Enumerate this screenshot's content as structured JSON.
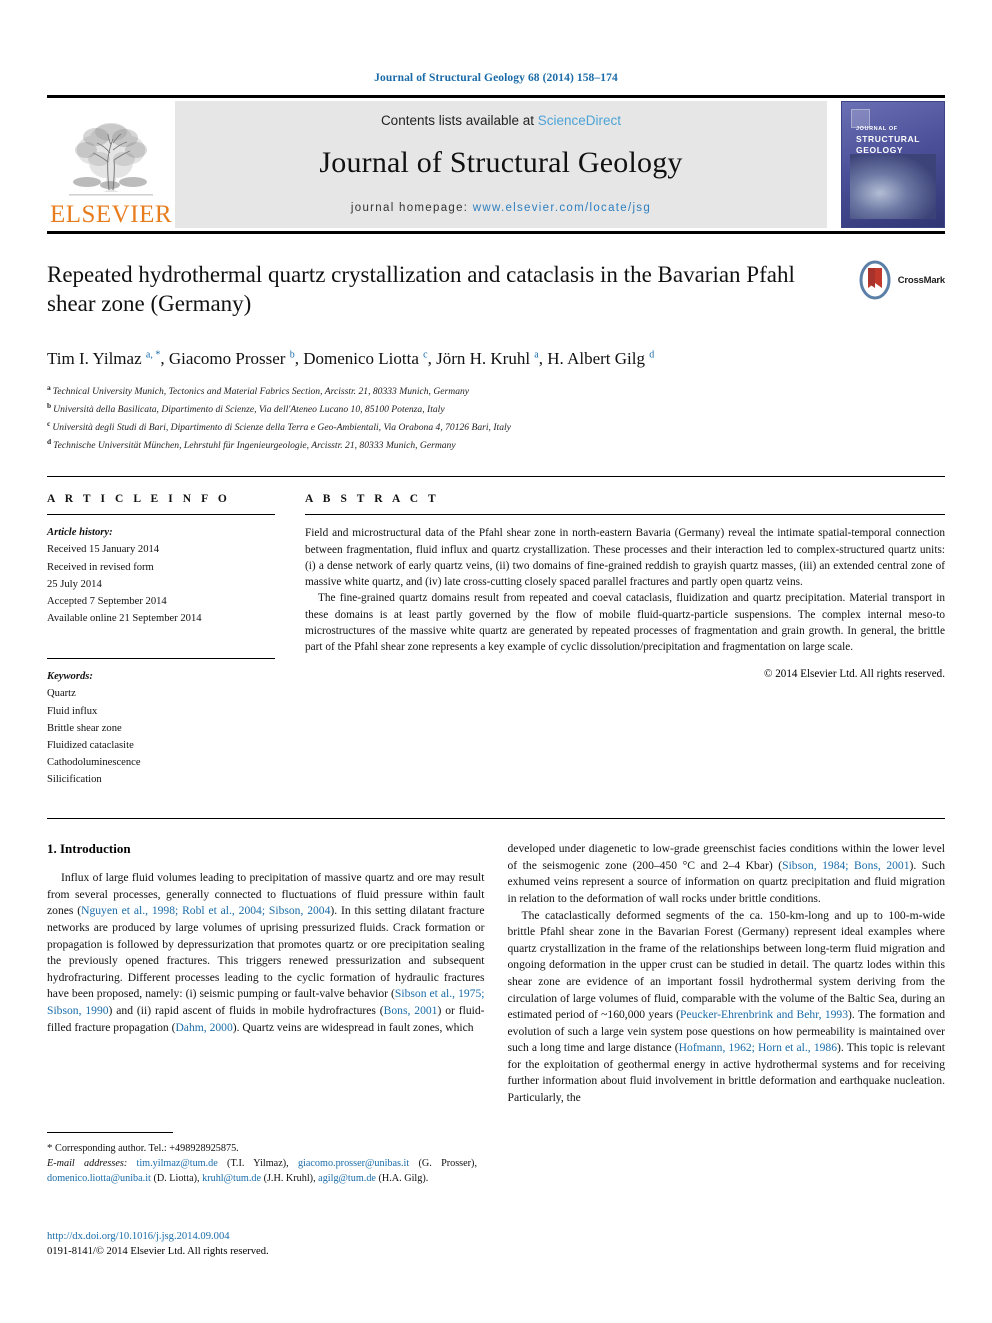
{
  "running_head": "Journal of Structural Geology 68 (2014) 158–174",
  "masthead": {
    "contents_prefix": "Contents lists available at ",
    "sciencedirect": "ScienceDirect",
    "journal_name": "Journal of Structural Geology",
    "homepage_prefix": "journal homepage: ",
    "homepage_url": "www.elsevier.com/locate/jsg",
    "publisher_wordmark": "ELSEVIER",
    "publisher_logo_icon": "elsevier-tree-icon",
    "cover_title_line1": "JOURNAL OF",
    "cover_title_line2": "STRUCTURAL",
    "cover_title_line3": "GEOLOGY"
  },
  "article": {
    "title": "Repeated hydrothermal quartz crystallization and cataclasis in the Bavarian Pfahl shear zone (Germany)",
    "crossmark_label": "CrossMark",
    "crossmark_icon": "crossmark-badge-icon",
    "authors_html": "Tim I. Yilmaz <sup>a, *</sup>, Giacomo Prosser <sup>b</sup>, Domenico Liotta <sup>c</sup>, Jörn H. Kruhl <sup>a</sup>, H. Albert Gilg <sup>d</sup>",
    "affiliations": [
      {
        "marker": "a",
        "text": "Technical University Munich, Tectonics and Material Fabrics Section, Arcisstr. 21, 80333 Munich, Germany"
      },
      {
        "marker": "b",
        "text": "Università della Basilicata, Dipartimento di Scienze, Via dell'Ateneo Lucano 10, 85100 Potenza, Italy"
      },
      {
        "marker": "c",
        "text": "Università degli Studi di Bari, Dipartimento di Scienze della Terra e Geo-Ambientali, Via Orabona 4, 70126 Bari, Italy"
      },
      {
        "marker": "d",
        "text": "Technische Universität München, Lehrstuhl für Ingenieurgeologie, Arcisstr. 21, 80333 Munich, Germany"
      }
    ]
  },
  "article_info": {
    "heading": "A R T I C L E   I N F O",
    "history_label": "Article history:",
    "history_lines": [
      "Received 15 January 2014",
      "Received in revised form",
      "25 July 2014",
      "Accepted 7 September 2014",
      "Available online 21 September 2014"
    ],
    "keywords_label": "Keywords:",
    "keywords": [
      "Quartz",
      "Fluid influx",
      "Brittle shear zone",
      "Fluidized cataclasite",
      "Cathodoluminescence",
      "Silicification"
    ]
  },
  "abstract": {
    "heading": "A B S T R A C T",
    "paragraphs": [
      "Field and microstructural data of the Pfahl shear zone in north-eastern Bavaria (Germany) reveal the intimate spatial-temporal connection between fragmentation, fluid influx and quartz crystallization. These processes and their interaction led to complex-structured quartz units: (i) a dense network of early quartz veins, (ii) two domains of fine-grained reddish to grayish quartz masses, (iii) an extended central zone of massive white quartz, and (iv) late cross-cutting closely spaced parallel fractures and partly open quartz veins.",
      "The fine-grained quartz domains result from repeated and coeval cataclasis, fluidization and quartz precipitation. Material transport in these domains is at least partly governed by the flow of mobile fluid-quartz-particle suspensions. The complex internal meso-to microstructures of the massive white quartz are generated by repeated processes of fragmentation and grain growth. In general, the brittle part of the Pfahl shear zone represents a key example of cyclic dissolution/precipitation and fragmentation on large scale."
    ],
    "copyright": "© 2014 Elsevier Ltd. All rights reserved."
  },
  "introduction": {
    "heading": "1. Introduction",
    "left_column_html": [
      "Influx of large fluid volumes leading to precipitation of massive quartz and ore may result from several processes, generally connected to fluctuations of fluid pressure within fault zones (<span class=\"ref\">Nguyen et al., 1998; Robl et al., 2004; Sibson, 2004</span>). In this setting dilatant fracture networks are produced by large volumes of uprising pressurized fluids. Crack formation or propagation is followed by depressurization that promotes quartz or ore precipitation sealing the previously opened fractures. This triggers renewed pressurization and subsequent hydrofracturing. Different processes leading to the cyclic formation of hydraulic fractures have been proposed, namely: (i) seismic pumping or fault-valve behavior (<span class=\"ref\">Sibson et al., 1975; Sibson, 1990</span>) and (ii) rapid ascent of fluids in mobile hydrofractures (<span class=\"ref\">Bons, 2001</span>) or fluid-filled fracture propagation (<span class=\"ref\">Dahm, 2000</span>). Quartz veins are widespread in fault zones, which"
    ],
    "right_column_html": [
      "developed under diagenetic to low-grade greenschist facies conditions within the lower level of the seismogenic zone (200–450 °C and 2–4 Kbar) (<span class=\"ref\">Sibson, 1984; Bons, 2001</span>). Such exhumed veins represent a source of information on quartz precipitation and fluid migration in relation to the deformation of wall rocks under brittle conditions.",
      "The cataclastically deformed segments of the ca. 150-km-long and up to 100-m-wide brittle Pfahl shear zone in the Bavarian Forest (Germany) represent ideal examples where quartz crystallization in the frame of the relationships between long-term fluid migration and ongoing deformation in the upper crust can be studied in detail. The quartz lodes within this shear zone are evidence of an important fossil hydrothermal system deriving from the circulation of large volumes of fluid, comparable with the volume of the Baltic Sea, during an estimated period of ~160,000 years (<span class=\"ref\">Peucker-Ehrenbrink and Behr, 1993</span>). The formation and evolution of such a large vein system pose questions on how permeability is maintained over such a long time and large distance (<span class=\"ref\">Hofmann, 1962; Horn et al., 1986</span>). This topic is relevant for the exploitation of geothermal energy in active hydrothermal systems and for receiving further information about fluid involvement in brittle deformation and earthquake nucleation. Particularly, the"
    ]
  },
  "footnotes": {
    "corresponding_html": "<span class=\"star\">*</span> Corresponding author. Tel.: +498928925875.",
    "email_html": "<em>E-mail addresses:</em> <span class=\"ref\">tim.yilmaz@tum.de</span> (T.I. Yilmaz), <span class=\"ref\">giacomo.prosser@unibas.it</span> (G. Prosser), <span class=\"ref\">domenico.liotta@uniba.it</span> (D. Liotta), <span class=\"ref\">kruhl@tum.de</span> (J.H. Kruhl), <span class=\"ref\">agilg@tum.de</span> (H.A. Gilg)."
  },
  "footer": {
    "doi": "http://dx.doi.org/10.1016/j.jsg.2014.09.004",
    "issn_line": "0191-8141/© 2014 Elsevier Ltd. All rights reserved."
  },
  "colors": {
    "link_blue": "#1a6ba8",
    "sciencedirect_blue": "#4da3d6",
    "elsevier_orange": "#E87D1E",
    "band_gray": "#e6e6e6",
    "cover_purple": "#5a60a8"
  }
}
